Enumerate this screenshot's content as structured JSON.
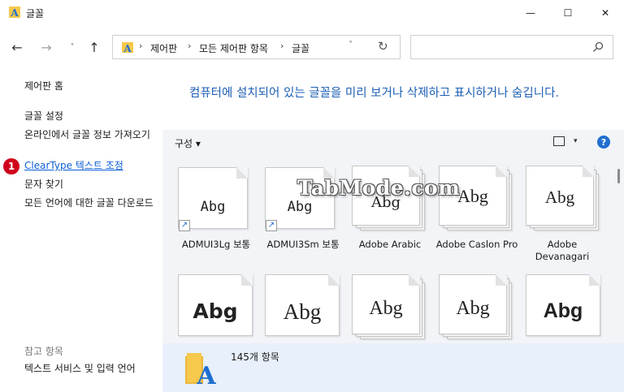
{
  "window": {
    "title": "글꼴",
    "minimize_glyph": "—",
    "maximize_glyph": "☐",
    "close_glyph": "✕"
  },
  "nav": {
    "back": "←",
    "forward": "→",
    "recent": "˅",
    "up": "↑"
  },
  "address": {
    "crumbs": [
      "제어판",
      "모든 제어판 항목",
      "글꼴"
    ],
    "separator": "›",
    "dropdown": "˅",
    "refresh": "↻"
  },
  "search": {
    "placeholder": ""
  },
  "left_pane": {
    "home": "제어판 홈",
    "settings": "글꼴 설정",
    "online_info": "온라인에서 글꼴 정보 가져오기",
    "cleartype": "ClearType 텍스트 조정",
    "find_char": "문자 찾기",
    "download": "모든 언어에 대한 글꼴 다운로드",
    "see_also": "참고 항목",
    "text_services": "텍스트 서비스 및 입력 언어",
    "badge": "1"
  },
  "description": "컴퓨터에 설치되어 있는 글꼴을 미리 보거나 삭제하고 표시하거나 숨깁니다.",
  "toolbar": {
    "organize": "구성",
    "organize_dd": "▾",
    "view_dd": "▾",
    "help": "?"
  },
  "sample_text": "Abg",
  "fonts": [
    {
      "name": "ADMUI3Lg 보통",
      "shortcut": true,
      "stacked": false
    },
    {
      "name": "ADMUI3Sm 보통",
      "shortcut": true,
      "stacked": false
    },
    {
      "name": "Adobe Arabic",
      "shortcut": false,
      "stacked": true
    },
    {
      "name": "Adobe Caslon Pro",
      "shortcut": false,
      "stacked": true
    },
    {
      "name": "Adobe Devanagari",
      "shortcut": false,
      "stacked": true
    }
  ],
  "shortcut_glyph": "↗",
  "details": {
    "count": "145개 항목"
  },
  "watermark": "TabMode.com",
  "colors": {
    "link": "#0b5ed7",
    "description": "#1d5fb5",
    "badge": "#d0021b",
    "details_bg": "#e8f0fb"
  }
}
